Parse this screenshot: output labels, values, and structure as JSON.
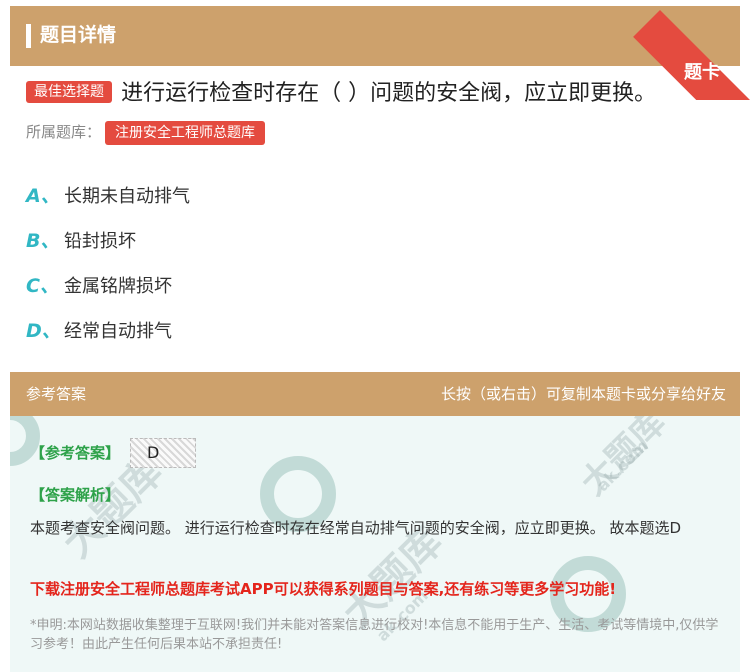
{
  "header": {
    "title": "题目详情",
    "ribbon_label": "题卡"
  },
  "question": {
    "type_badge": "最佳选择题",
    "text": "进行运行检查时存在（ ）问题的安全阀，应立即更换。",
    "bank_label": "所属题库：",
    "bank_name": "注册安全工程师总题库"
  },
  "options": [
    {
      "letter": "A、",
      "text": "长期未自动排气"
    },
    {
      "letter": "B、",
      "text": "铅封损坏"
    },
    {
      "letter": "C、",
      "text": "金属铭牌损坏"
    },
    {
      "letter": "D、",
      "text": "经常自动排气"
    }
  ],
  "answer_section": {
    "title": "参考答案",
    "hint": "长按（或右击）可复制本题卡或分享给好友",
    "answer_label": "【参考答案】",
    "answer_value": "D",
    "explanation_label": "【答案解析】",
    "explanation_text": "本题考查安全阀问题。 进行运行检查时存在经常自动排气问题的安全阀，应立即更换。 故本题选D",
    "promo_text": "下载注册安全工程师总题库考试APP可以获得系列题目与答案,还有练习等更多学习功能!",
    "disclaimer": "*申明:本网站数据收集整理于互联网!我们并未能对答案信息进行校对!本信息不能用于生产、生活、考试等情境中,仅供学习参考！由此产生任何后果本站不承担责任!"
  },
  "watermark": {
    "text": "大题库",
    "url": "ak.com"
  },
  "colors": {
    "header_bg": "#cda16c",
    "badge_red": "#e44b3f",
    "option_letter": "#31b7c4",
    "answer_green": "#2ea24a",
    "promo_red": "#e4251c",
    "answer_box_bg": "#eff8f7"
  }
}
